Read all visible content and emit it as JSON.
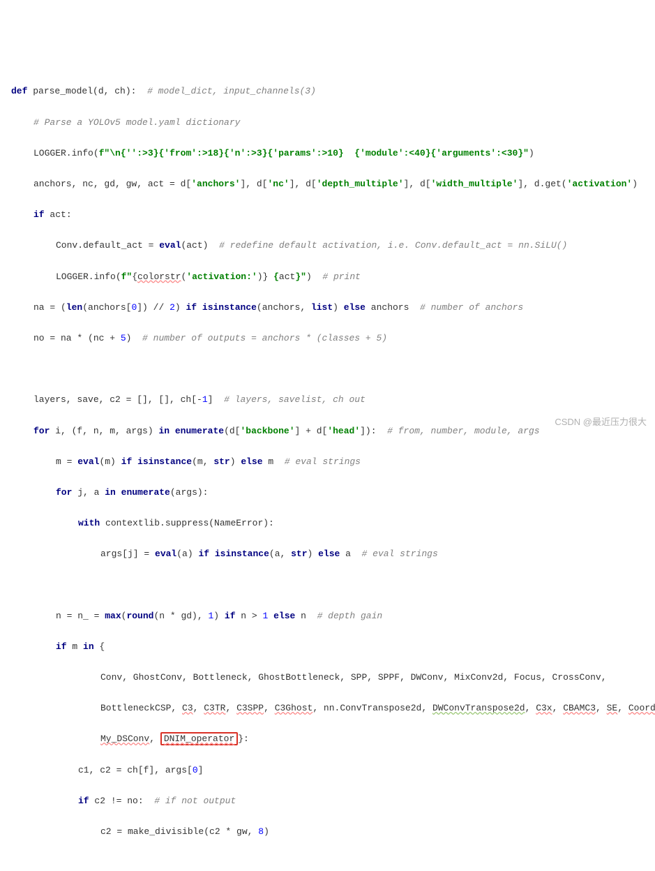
{
  "code": {
    "l1": {
      "def": "def",
      "fn": "parse_model",
      "args": "(d, ch):",
      "cm": "  # model_dict, input_channels(3)"
    },
    "l2": {
      "cm": "# Parse a YOLOv5 model.yaml dictionary"
    },
    "l3": {
      "a": "LOGGER.info(",
      "b": "f\"\\n{'':>3}{'from':>18}{'n':>3}{'params':>10}  {'module':<40}{'arguments':<30}\"",
      "c": ")"
    },
    "l4": {
      "a": "anchors, nc, gd, gw, act = d[",
      "b": "'anchors'",
      "c": "], d[",
      "d": "'nc'",
      "e": "], d[",
      "f": "'depth_multiple'",
      "g": "], d[",
      "h": "'width_multiple'",
      "i": "], d.get(",
      "j": "'activation'",
      "k": ")"
    },
    "l5": {
      "a": "if",
      "b": " act:"
    },
    "l6": {
      "a": "Conv.default_act = ",
      "b": "eval",
      "c": "(act)",
      "cm": "  # redefine default activation, i.e. Conv.default_act = nn.SiLU()"
    },
    "l7": {
      "a": "LOGGER.info(",
      "b": "f\"",
      "c": "{",
      "d": "colorstr",
      "e": "(",
      "f": "'activation:'",
      "g": ")}",
      "h": " {",
      "i": "act",
      "j": "}\"",
      "k": ")",
      "cm": "  # print"
    },
    "l8": {
      "a": "na = (",
      "b": "len",
      "c": "(anchors[",
      "d": "0",
      "e": "]) // ",
      "f": "2",
      "g": ") ",
      "h": "if",
      "i": " ",
      "j": "isinstance",
      "k": "(anchors, ",
      "l": "list",
      "m": ") ",
      "n": "else",
      "o": " anchors",
      "cm": "  # number of anchors"
    },
    "l9": {
      "a": "no = na * (nc + ",
      "b": "5",
      "c": ")",
      "cm": "  # number of outputs = anchors * (classes + 5)"
    },
    "l10": {
      "a": "layers, save, c2 = [], [], ch[-",
      "b": "1",
      "c": "]",
      "cm": "  # layers, savelist, ch out"
    },
    "l11": {
      "a": "for",
      "b": " i, (f, n, m, args) ",
      "c": "in",
      "d": " ",
      "e": "enumerate",
      "f": "(d[",
      "g": "'backbone'",
      "h": "] + d[",
      "i": "'head'",
      "j": "]):",
      "cm": "  # from, number, module, args"
    },
    "l12": {
      "a": "m = ",
      "b": "eval",
      "c": "(m) ",
      "d": "if",
      "e": " ",
      "f": "isinstance",
      "g": "(m, ",
      "h": "str",
      "i": ") ",
      "j": "else",
      "k": " m",
      "cm": "  # eval strings"
    },
    "l13": {
      "a": "for",
      "b": " j, a ",
      "c": "in",
      "d": " ",
      "e": "enumerate",
      "f": "(args):"
    },
    "l14": {
      "a": "with",
      "b": " contextlib.suppress(NameError):"
    },
    "l15": {
      "a": "args[j] = ",
      "b": "eval",
      "c": "(a) ",
      "d": "if",
      "e": " ",
      "f": "isinstance",
      "g": "(a, ",
      "h": "str",
      "i": ") ",
      "j": "else",
      "k": " a",
      "cm": "  # eval strings"
    },
    "l16": {
      "a": "n = n_ = ",
      "b": "max",
      "c": "(",
      "d": "round",
      "e": "(n * gd), ",
      "f": "1",
      "g": ") ",
      "h": "if",
      "i": " n > ",
      "j": "1",
      "k": " ",
      "l": "else",
      "m": " n",
      "cm": "  # depth gain"
    },
    "l17": {
      "a": "if",
      "b": " m ",
      "c": "in",
      "d": " {"
    },
    "l18": "Conv, GhostConv, Bottleneck, GhostBottleneck, SPP, SPPF, DWConv, MixConv2d, Focus, CrossConv,",
    "l19": {
      "a": "BottleneckCSP, ",
      "b": "C3",
      "c": ", ",
      "d": "C3TR",
      "e": ", ",
      "f": "C3SPP",
      "g": ", ",
      "h": "C3Ghost",
      "i": ", nn.ConvTranspose2d, ",
      "j": "DWConvTranspose2d",
      "k": ", ",
      "l": "C3x",
      "m": ", ",
      "n": "CBAMC3",
      "o": ", ",
      "p": "SE",
      "q": ", ",
      "r": "CoordAtt",
      "s": ","
    },
    "l20": {
      "a": "My_DSConv",
      "b": ", ",
      "c": "DNIM_operator",
      "d": "}:"
    },
    "l21": {
      "a": "c1, c2 = ch[f], args[",
      "b": "0",
      "c": "]"
    },
    "l22": {
      "a": "if",
      "b": " c2 != no:",
      "cm": "  # if not output"
    },
    "l23": {
      "a": "c2 = make_divisible(c2 * gw, ",
      "b": "8",
      "c": ")"
    }
  },
  "watermark": "CSDN @最近压力很大"
}
